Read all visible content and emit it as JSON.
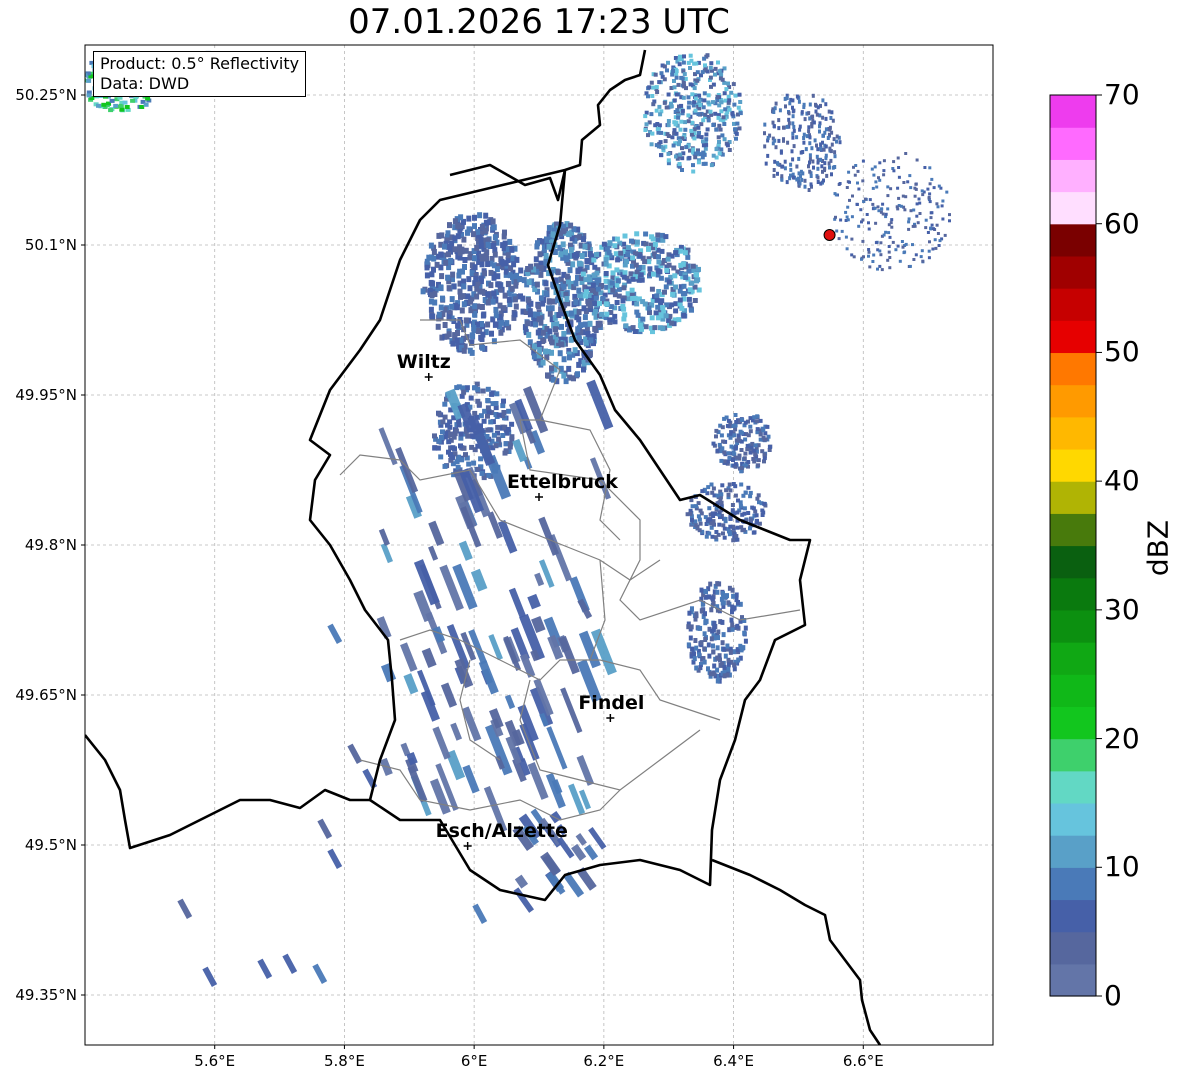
{
  "title": "07.01.2026 17:23 UTC",
  "info_box": {
    "product": "Product: 0.5° Reflectivity",
    "data": "Data: DWD"
  },
  "axes": {
    "lon_range": [
      5.4,
      6.8
    ],
    "lat_range": [
      49.3,
      50.3
    ],
    "lon_ticks": [
      {
        "value": 5.6,
        "label": "5.6°E"
      },
      {
        "value": 5.8,
        "label": "5.8°E"
      },
      {
        "value": 6.0,
        "label": "6°E"
      },
      {
        "value": 6.2,
        "label": "6.2°E"
      },
      {
        "value": 6.4,
        "label": "6.4°E"
      },
      {
        "value": 6.6,
        "label": "6.6°E"
      }
    ],
    "lat_ticks": [
      {
        "value": 50.25,
        "label": "50.25°N"
      },
      {
        "value": 50.1,
        "label": "50.1°N"
      },
      {
        "value": 49.95,
        "label": "49.95°N"
      },
      {
        "value": 49.8,
        "label": "49.8°N"
      },
      {
        "value": 49.65,
        "label": "49.65°N"
      },
      {
        "value": 49.5,
        "label": "49.5°N"
      },
      {
        "value": 49.35,
        "label": "49.35°N"
      }
    ],
    "grid": true
  },
  "cities": [
    {
      "name": "Wiltz",
      "lon": 5.93,
      "lat": 49.968
    },
    {
      "name": "Ettelbruck",
      "lon": 6.1,
      "lat": 49.848
    },
    {
      "name": "Findel",
      "lon": 6.21,
      "lat": 49.627
    },
    {
      "name": "Esch/Alzette",
      "lon": 5.99,
      "lat": 49.499
    }
  ],
  "radar_site": {
    "lon": 6.548,
    "lat": 50.11,
    "color": "#e01010"
  },
  "colorbar": {
    "label": "dBZ",
    "min": 0,
    "max": 70,
    "ticks": [
      0,
      10,
      20,
      30,
      40,
      50,
      60,
      70
    ],
    "colors": [
      "#6375a8",
      "#56679e",
      "#4660a8",
      "#4a7ab8",
      "#59a0c8",
      "#66c4dd",
      "#62d8c4",
      "#3ed06c",
      "#12c61e",
      "#10b818",
      "#10a814",
      "#0c9010",
      "#0a7a0e",
      "#0a6010",
      "#487a0c",
      "#b0b404",
      "#ffd800",
      "#ffb800",
      "#ff9a00",
      "#ff7800",
      "#e60000",
      "#c60000",
      "#a00000",
      "#7a0000",
      "#ffdeff",
      "#ffb0ff",
      "#ff6aff",
      "#ee3cee"
    ]
  },
  "map_colors": {
    "country_border": "#000000",
    "canton_border": "#808080",
    "grid": "#b8b8b8"
  }
}
